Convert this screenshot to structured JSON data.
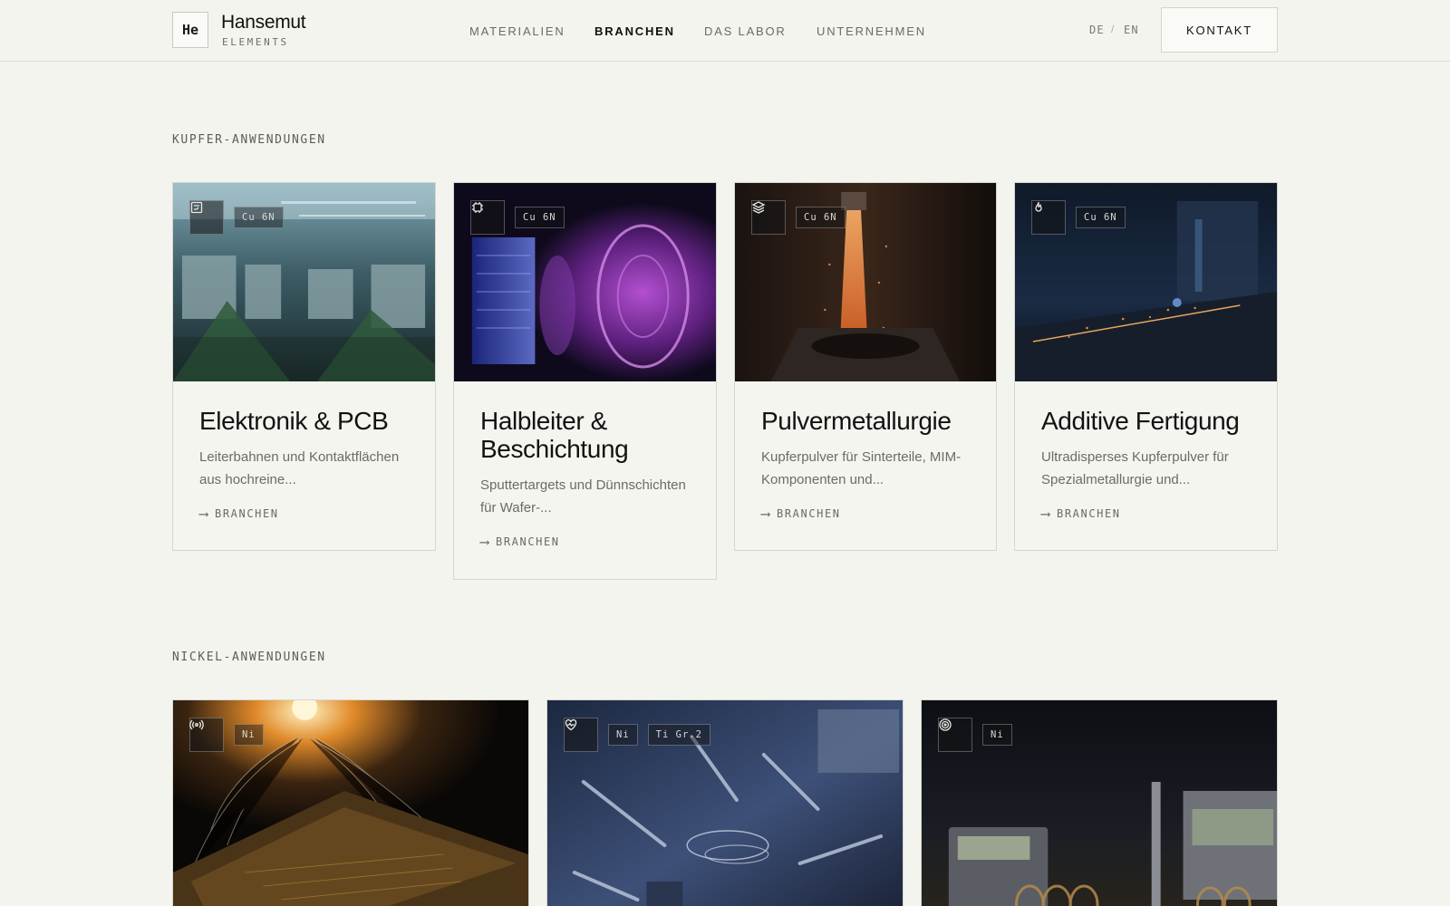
{
  "header": {
    "logo_symbol": "He",
    "brand_name": "Hansemut",
    "brand_sub": "ELEMENTS",
    "nav": [
      {
        "label": "MATERIALIEN",
        "active": false
      },
      {
        "label": "BRANCHEN",
        "active": true
      },
      {
        "label": "DAS LABOR",
        "active": false
      },
      {
        "label": "UNTERNEHMEN",
        "active": false
      }
    ],
    "lang_de": "DE",
    "lang_sep": "/",
    "lang_en": "EN",
    "contact": "KONTAKT"
  },
  "copper": {
    "title": "KUPFER-ANWENDUNGEN",
    "cards": [
      {
        "icon": "circuit-board-icon",
        "tags": [
          "Cu 6N"
        ],
        "title": "Elektronik & PCB",
        "desc": "Leiterbahnen und Kontaktflächen aus hochreine...",
        "link": "BRANCHEN",
        "arrow": "⟶"
      },
      {
        "icon": "chip-icon",
        "tags": [
          "Cu 6N"
        ],
        "title": "Halbleiter & Beschichtung",
        "desc": "Sputtertargets und Dünnschichten für Wafer-...",
        "link": "BRANCHEN",
        "arrow": "⟶"
      },
      {
        "icon": "layers-icon",
        "tags": [
          "Cu 6N"
        ],
        "title": "Pulvermetallurgie",
        "desc": "Kupferpulver für Sinterteile, MIM-Komponenten und...",
        "link": "BRANCHEN",
        "arrow": "⟶"
      },
      {
        "icon": "flame-icon",
        "tags": [
          "Cu 6N"
        ],
        "title": "Additive Fertigung",
        "desc": "Ultradisperses Kupferpulver für Spezialmetallurgie und...",
        "link": "BRANCHEN",
        "arrow": "⟶"
      }
    ]
  },
  "nickel": {
    "title": "NICKEL-ANWENDUNGEN",
    "cards": [
      {
        "icon": "radio-signal-icon",
        "tags": [
          "Ni"
        ]
      },
      {
        "icon": "heart-pulse-icon",
        "tags": [
          "Ni",
          "Ti Gr.2"
        ]
      },
      {
        "icon": "target-icon",
        "tags": [
          "Ni"
        ]
      }
    ]
  }
}
